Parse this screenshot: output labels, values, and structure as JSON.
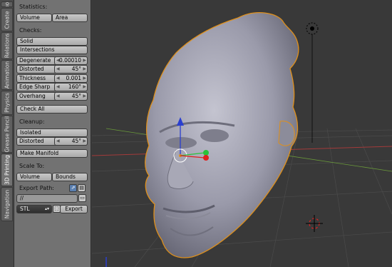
{
  "tabs": [
    "Navigation",
    "3D Printing",
    "Grease Pencil",
    "Physics",
    "Animation",
    "Relations",
    "Create",
    "Tools"
  ],
  "stats": {
    "label": "Statistics:",
    "volume": "Volume",
    "area": "Area"
  },
  "checks": {
    "label": "Checks:",
    "solid": "Solid",
    "intersections": "Intersections",
    "degenerate": {
      "label": "Degenerate",
      "value": "0.00010"
    },
    "distorted": {
      "label": "Distorted",
      "value": "45°"
    },
    "thickness": {
      "label": "Thickness",
      "value": "0.001"
    },
    "edge_sharp": {
      "label": "Edge Sharp",
      "value": "160°"
    },
    "overhang": {
      "label": "Overhang",
      "value": "45°"
    },
    "check_all": "Check All"
  },
  "cleanup": {
    "label": "Cleanup:",
    "isolated": "Isolated",
    "distorted": {
      "label": "Distorted",
      "value": "45°"
    },
    "make_manifold": "Make Manifold"
  },
  "scale_to": {
    "label": "Scale To:",
    "volume": "Volume",
    "bounds": "Bounds"
  },
  "export": {
    "label": "Export Path:",
    "path": "//",
    "format": "STL",
    "button": "Export"
  },
  "colors": {
    "panel": "#727272",
    "viewport_bg": "#393939",
    "grid": "#4b4b4b",
    "axis_x": "#a33a3a",
    "axis_y": "#6a9a3a",
    "mesh": "#9a9aaa",
    "selection_outline": "#e0901a",
    "gizmo_z": "#2a3fd0",
    "gizmo_y": "#29c23a",
    "gizmo_x": "#e02020"
  }
}
